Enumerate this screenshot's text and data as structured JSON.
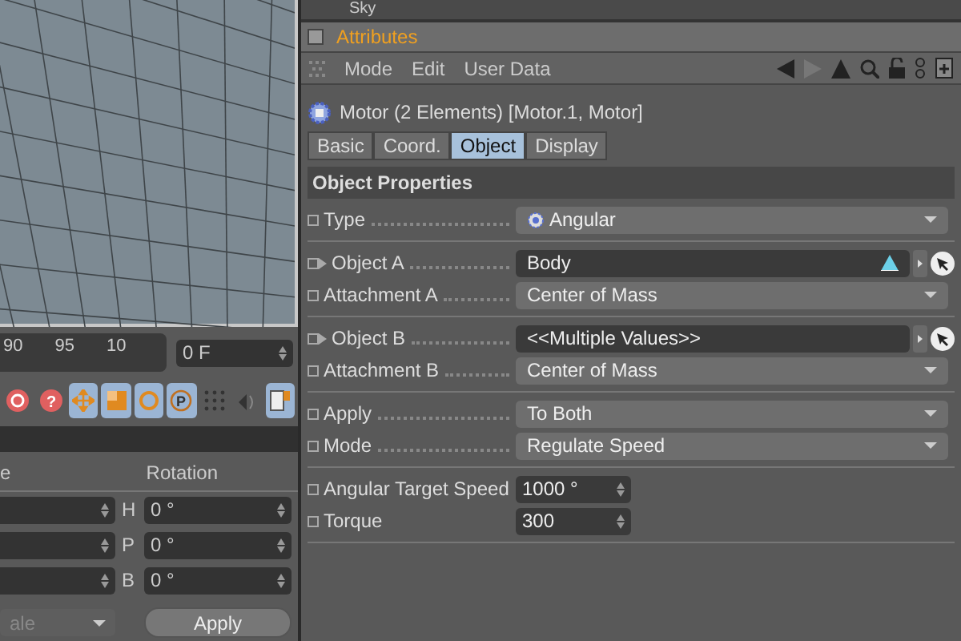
{
  "timeline": {
    "ticks": [
      "90",
      "95",
      "10"
    ],
    "frame_field": "0 F"
  },
  "toolbar": [
    {
      "kind": "record",
      "selected": false
    },
    {
      "kind": "help",
      "selected": false,
      "glyph": "?"
    },
    {
      "kind": "move",
      "selected": true
    },
    {
      "kind": "scale",
      "selected": true
    },
    {
      "kind": "rotate",
      "selected": true
    },
    {
      "kind": "param",
      "selected": true,
      "glyph": "P"
    },
    {
      "kind": "dots",
      "selected": false
    },
    {
      "kind": "sound",
      "selected": false
    },
    {
      "kind": "doc",
      "selected": true
    }
  ],
  "coordinates": {
    "column_1": "e",
    "column_2": "Rotation",
    "rows": [
      {
        "axis": "H",
        "value": "0 °"
      },
      {
        "axis": "P",
        "value": "0 °"
      },
      {
        "axis": "B",
        "value": "0 °"
      }
    ],
    "dropdown": {
      "value": "ale",
      "disabled": true
    },
    "apply_button": "Apply"
  },
  "object_list": {
    "item": "Sky"
  },
  "attributes": {
    "checked": false,
    "title": "Attributes",
    "menu": [
      "Mode",
      "Edit",
      "User Data"
    ],
    "object_title": "Motor (2 Elements) [Motor.1, Motor]",
    "tabs": [
      {
        "label": "Basic",
        "selected": false
      },
      {
        "label": "Coord.",
        "selected": false
      },
      {
        "label": "Object",
        "selected": true
      },
      {
        "label": "Display",
        "selected": false
      }
    ],
    "section": "Object Properties",
    "groups": [
      [
        {
          "kind": "dropdown",
          "label": "Type",
          "value": "Angular",
          "value_icon": true
        }
      ],
      [
        {
          "kind": "link",
          "label": "Object A",
          "value": "Body",
          "value_icon": true
        },
        {
          "kind": "dropdown",
          "label": "Attachment A",
          "value": "Center of Mass"
        }
      ],
      [
        {
          "kind": "link",
          "label": "Object B",
          "value": "<<Multiple Values>>",
          "value_icon": false
        },
        {
          "kind": "dropdown",
          "label": "Attachment B",
          "value": "Center of Mass"
        }
      ],
      [
        {
          "kind": "dropdown",
          "label": "Apply",
          "value": "To Both"
        },
        {
          "kind": "dropdown",
          "label": "Mode",
          "value": "Regulate Speed"
        }
      ],
      [
        {
          "kind": "number",
          "label": "Angular Target Speed",
          "value": "1000 °"
        },
        {
          "kind": "number",
          "label": "Torque",
          "value": "300"
        }
      ]
    ]
  }
}
